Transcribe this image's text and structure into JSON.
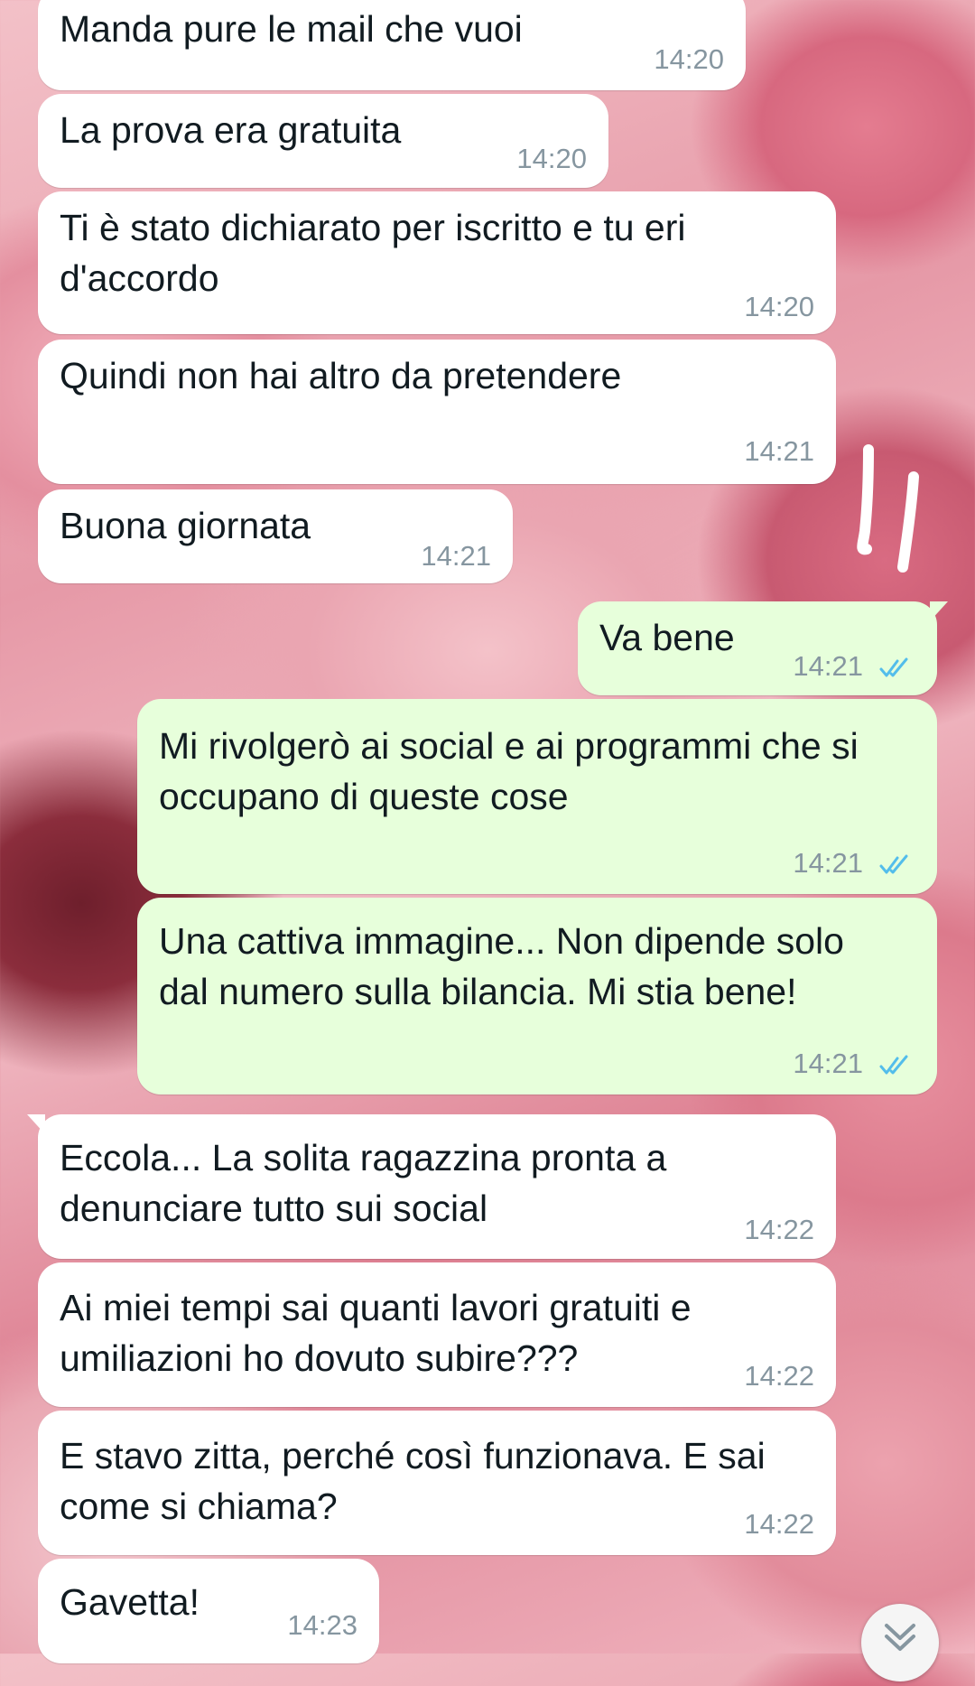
{
  "chat": {
    "messages": [
      {
        "direction": "in",
        "text": "Manda pure le mail che vuoi",
        "time": "14:20"
      },
      {
        "direction": "in",
        "text": "La prova era gratuita",
        "time": "14:20"
      },
      {
        "direction": "in",
        "text": "Ti è stato dichiarato per iscritto e tu eri d'accordo",
        "time": "14:20"
      },
      {
        "direction": "in",
        "text": "Quindi non hai altro da pretendere",
        "time": "14:21"
      },
      {
        "direction": "in",
        "text": "Buona giornata",
        "time": "14:21"
      },
      {
        "direction": "out",
        "text": "Va bene",
        "time": "14:21",
        "status": "read"
      },
      {
        "direction": "out",
        "text": "Mi rivolgerò ai social e ai programmi che si occupano di queste cose",
        "time": "14:21",
        "status": "read"
      },
      {
        "direction": "out",
        "text": "Una cattiva immagine... Non dipende solo dal numero sulla bilancia. Mi stia bene!",
        "time": "14:21",
        "status": "read"
      },
      {
        "direction": "in",
        "text": "Eccola... La solita ragazzina pronta a denunciare tutto sui social",
        "time": "14:22"
      },
      {
        "direction": "in",
        "text": "Ai miei tempi sai quanti lavori gratuiti e umiliazioni ho dovuto subire???",
        "time": "14:22"
      },
      {
        "direction": "in",
        "text": "E stavo zitta, perché così funzionava. E sai come si chiama?",
        "time": "14:22"
      },
      {
        "direction": "in",
        "text": "Gavetta!",
        "time": "14:23"
      }
    ]
  },
  "colors": {
    "incoming_bubble": "#ffffff",
    "outgoing_bubble": "#e7ffdb",
    "timestamp": "#8696a0",
    "read_ticks": "#53bdeb",
    "text": "#111b21"
  },
  "icons": {
    "read_receipt": "double-check-icon",
    "scroll_down": "chevron-double-down-icon"
  }
}
